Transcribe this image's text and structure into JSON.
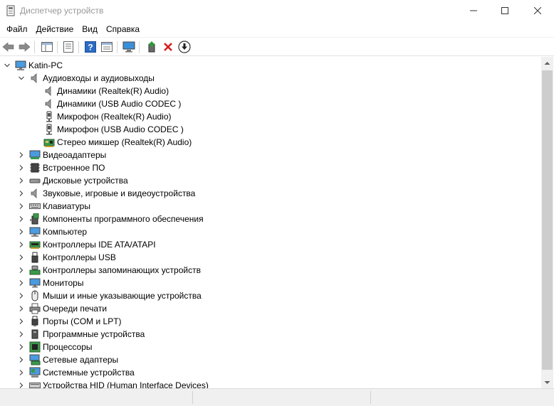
{
  "window": {
    "title": "Диспетчер устройств",
    "icon": "device-manager-icon"
  },
  "menu": {
    "items": [
      "Файл",
      "Действие",
      "Вид",
      "Справка"
    ]
  },
  "toolbar": {
    "buttons": [
      "back-arrow-icon",
      "forward-arrow-icon",
      "show-hide-tree-icon",
      "properties-icon",
      "help-icon",
      "action-view-icon",
      "scan-hardware-monitor-icon",
      "update-driver-icon",
      "uninstall-x-icon",
      "download-driver-icon"
    ]
  },
  "tree": {
    "root": "Katin-PC",
    "expanded_category": "Аудиовходы и аудиовыходы",
    "audio_children": [
      "Динамики (Realtek(R) Audio)",
      "Динамики (USB Audio CODEC )",
      "Микрофон (Realtek(R) Audio)",
      "Микрофон (USB Audio CODEC )",
      "Стерео микшер (Realtek(R) Audio)"
    ],
    "categories": [
      "Видеоадаптеры",
      "Встроенное ПО",
      "Дисковые устройства",
      "Звуковые, игровые и видеоустройства",
      "Клавиатуры",
      "Компоненты программного обеспечения",
      "Компьютер",
      "Контроллеры IDE ATA/ATAPI",
      "Контроллеры USB",
      "Контроллеры запоминающих устройств",
      "Мониторы",
      "Мыши и иные указывающие устройства",
      "Очереди печати",
      "Порты (COM и LPT)",
      "Программные устройства",
      "Процессоры",
      "Сетевые адаптеры",
      "Системные устройства",
      "Устройства HID (Human Interface Devices)"
    ]
  },
  "colors": {
    "accent_red": "#d81e1e",
    "accent_blue": "#2b6cc4",
    "accent_green": "#2e9a3a"
  }
}
